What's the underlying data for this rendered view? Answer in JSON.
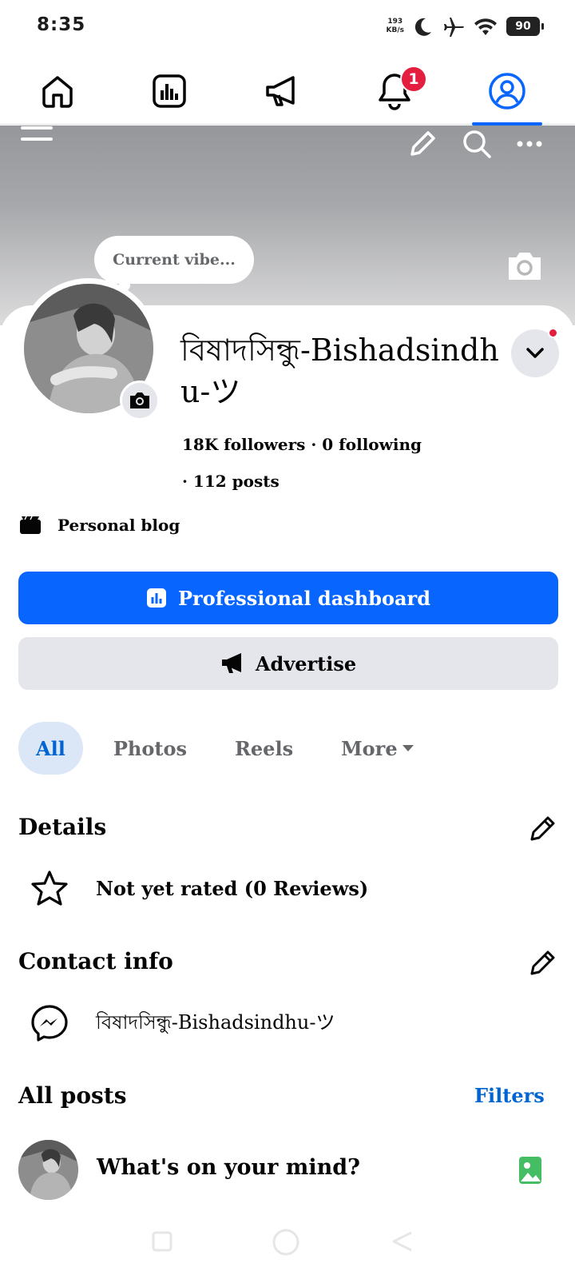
{
  "status_bar": {
    "time": "8:35",
    "speed_value": "193",
    "speed_unit": "KB/s",
    "battery": "90",
    "icons": [
      "moon-icon",
      "airplane-icon",
      "wifi-icon",
      "battery-icon"
    ]
  },
  "top_nav": {
    "items": [
      "home-icon",
      "insights-icon",
      "megaphone-icon",
      "bell-icon",
      "profile-icon"
    ],
    "notification_count": "1",
    "active_index": 4
  },
  "cover": {
    "icons": [
      "menu-icon",
      "pencil-icon",
      "search-icon",
      "more-icon",
      "camera-icon"
    ]
  },
  "profile": {
    "note": "Current vibe...",
    "name": "বিষাদসিন্ধু-Bishadsindhu-ツ",
    "followers_line": "18K followers · 0 following",
    "posts_line": "· 112 posts",
    "category": "Personal blog"
  },
  "buttons": {
    "primary": "Professional dashboard",
    "secondary": "Advertise"
  },
  "tabs": {
    "items": [
      "All",
      "Photos",
      "Reels",
      "More"
    ],
    "active": "All"
  },
  "details": {
    "title": "Details",
    "rating": "Not yet rated (0 Reviews)"
  },
  "contact": {
    "title": "Contact info",
    "messenger": "বিষাদসিন্ধু-Bishadsindhu-ツ"
  },
  "posts": {
    "title": "All posts",
    "filters": "Filters",
    "composer_placeholder": "What's on your mind?"
  },
  "colors": {
    "accent": "#0866ff",
    "link": "#0064d1",
    "badge": "#e41e3f",
    "photo": "#45bd62"
  }
}
